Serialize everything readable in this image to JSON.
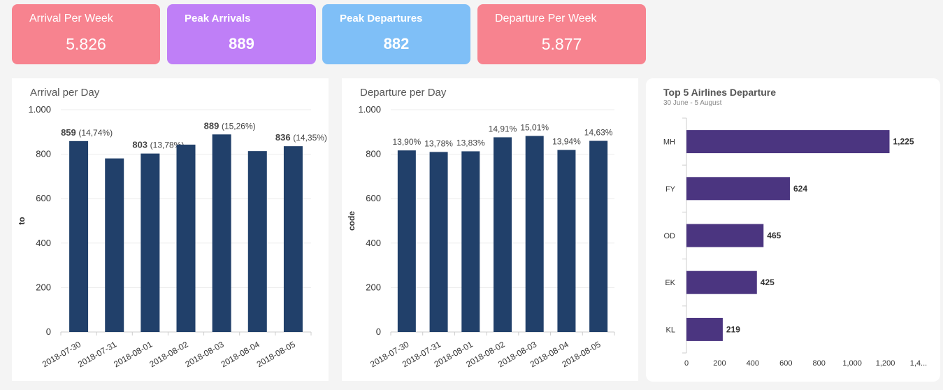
{
  "kpis": [
    {
      "label": "Arrival Per Week",
      "value": "5.826",
      "color": "#f7838f"
    },
    {
      "label": "Peak Arrivals",
      "value": "889",
      "color": "#bf7ff7"
    },
    {
      "label": "Peak Departures",
      "value": "882",
      "color": "#7fbff7"
    },
    {
      "label": "Departure Per Week",
      "value": "5.877",
      "color": "#f7838f"
    }
  ],
  "panels": {
    "arrival_title": "Arrival per Day",
    "departure_title": "Departure per Day",
    "airlines_title": "Top 5 Airlines Departure",
    "airlines_subtitle": "30 June - 5 August"
  },
  "chart_data": [
    {
      "type": "bar",
      "title": "Arrival per Day",
      "xlabel": "",
      "ylabel": "to",
      "ylim": [
        0,
        1000
      ],
      "yticks": [
        0,
        200,
        400,
        600,
        800,
        1000
      ],
      "ytick_labels": [
        "0",
        "200",
        "400",
        "600",
        "800",
        "1.000"
      ],
      "categories": [
        "2018-07-30",
        "2018-07-31",
        "2018-08-01",
        "2018-08-02",
        "2018-08-03",
        "2018-08-04",
        "2018-08-05"
      ],
      "values": [
        859,
        781,
        803,
        843,
        889,
        814,
        836
      ],
      "data_labels": [
        {
          "value": "859",
          "pct": "(14,74%)"
        },
        null,
        {
          "value": "803",
          "pct": "(13,78%)"
        },
        null,
        {
          "value": "889",
          "pct": "(15,26%)"
        },
        null,
        {
          "value": "836",
          "pct": "(14,35%)"
        }
      ],
      "bar_color": "#21406a",
      "grid": true
    },
    {
      "type": "bar",
      "title": "Departure per Day",
      "xlabel": "",
      "ylabel": "code",
      "ylim": [
        0,
        1000
      ],
      "yticks": [
        0,
        200,
        400,
        600,
        800,
        1000
      ],
      "ytick_labels": [
        "0",
        "200",
        "400",
        "600",
        "800",
        "1.000"
      ],
      "categories": [
        "2018-07-30",
        "2018-07-31",
        "2018-08-01",
        "2018-08-02",
        "2018-08-03",
        "2018-08-04",
        "2018-08-05"
      ],
      "values": [
        817,
        810,
        813,
        876,
        882,
        819,
        860
      ],
      "data_labels": [
        "13,90%",
        "13,78%",
        "13,83%",
        "14,91%",
        "15,01%",
        "13,94%",
        "14,63%"
      ],
      "bar_color": "#21406a",
      "grid": true
    },
    {
      "type": "bar",
      "orientation": "horizontal",
      "title": "Top 5 Airlines Departure",
      "subtitle": "30 June - 5 August",
      "categories": [
        "MH",
        "FY",
        "OD",
        "EK",
        "KL"
      ],
      "values": [
        1225,
        624,
        465,
        425,
        219
      ],
      "data_labels": [
        "1,225",
        "624",
        "465",
        "425",
        "219"
      ],
      "xticks": [
        0,
        200,
        400,
        600,
        800,
        1000,
        1200,
        1400
      ],
      "xtick_labels": [
        "0",
        "200",
        "400",
        "600",
        "800",
        "1,000",
        "1,200",
        "1,4..."
      ],
      "xlim": [
        0,
        1400
      ],
      "bar_color": "#4b3580",
      "grid": false
    }
  ]
}
